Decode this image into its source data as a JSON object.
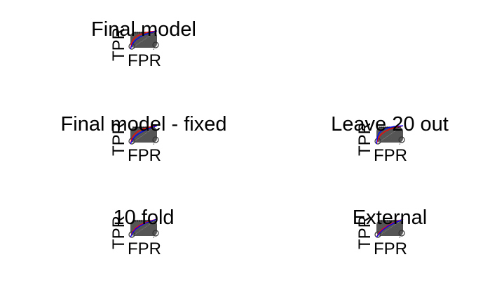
{
  "chart_data": [
    {
      "type": "line",
      "title": "Final model",
      "xlabel": "FPR",
      "ylabel": "TPR",
      "xlim": [
        0,
        1
      ],
      "ylim": [
        0,
        1
      ],
      "series": [
        {
          "color": "#ff0000",
          "x": [
            0,
            0.05,
            0.12,
            0.25,
            0.45,
            0.7,
            1
          ],
          "y": [
            0,
            0.35,
            0.55,
            0.72,
            0.85,
            0.95,
            1
          ]
        },
        {
          "color": "#0000ff",
          "x": [
            0,
            0.08,
            0.2,
            0.35,
            0.55,
            0.8,
            1
          ],
          "y": [
            0,
            0.3,
            0.5,
            0.66,
            0.8,
            0.92,
            1
          ]
        }
      ]
    },
    {
      "type": "line",
      "title": "Final model - fixed",
      "xlabel": "FPR",
      "ylabel": "TPR",
      "xlim": [
        0,
        1
      ],
      "ylim": [
        0,
        1
      ],
      "series": [
        {
          "color": "#ff0000",
          "x": [
            0,
            0.06,
            0.15,
            0.3,
            0.5,
            0.75,
            1
          ],
          "y": [
            0,
            0.32,
            0.52,
            0.7,
            0.83,
            0.94,
            1
          ]
        },
        {
          "color": "#0000ff",
          "x": [
            0,
            0.1,
            0.22,
            0.4,
            0.6,
            0.82,
            1
          ],
          "y": [
            0,
            0.28,
            0.47,
            0.64,
            0.78,
            0.91,
            1
          ]
        }
      ]
    },
    {
      "type": "line",
      "title": "Leave 20 out",
      "xlabel": "FPR",
      "ylabel": "TPR",
      "xlim": [
        0,
        1
      ],
      "ylim": [
        0,
        1
      ],
      "series": [
        {
          "color": "#ff0000",
          "x": [
            0,
            0.07,
            0.16,
            0.32,
            0.52,
            0.76,
            1
          ],
          "y": [
            0,
            0.3,
            0.5,
            0.68,
            0.82,
            0.93,
            1
          ]
        },
        {
          "color": "#0000ff",
          "x": [
            0,
            0.04,
            0.1,
            0.22,
            0.4,
            0.66,
            1
          ],
          "y": [
            0,
            0.4,
            0.6,
            0.76,
            0.87,
            0.96,
            1
          ]
        }
      ]
    },
    {
      "type": "line",
      "title": "10 fold",
      "xlabel": "FPR",
      "ylabel": "TPR",
      "xlim": [
        0,
        1
      ],
      "ylim": [
        0,
        1
      ],
      "series": [
        {
          "color": "#ff0000",
          "x": [
            0,
            0.08,
            0.18,
            0.34,
            0.54,
            0.78,
            1
          ],
          "y": [
            0,
            0.29,
            0.49,
            0.66,
            0.8,
            0.92,
            1
          ]
        },
        {
          "color": "#0000ff",
          "x": [
            0,
            0.09,
            0.2,
            0.37,
            0.57,
            0.8,
            1
          ],
          "y": [
            0,
            0.27,
            0.46,
            0.63,
            0.78,
            0.9,
            1
          ]
        }
      ]
    },
    {
      "type": "line",
      "title": "External",
      "xlabel": "FPR",
      "ylabel": "TPR",
      "xlim": [
        0,
        1
      ],
      "ylim": [
        0,
        1
      ],
      "series": [
        {
          "color": "#ff0000",
          "x": [
            0,
            0.1,
            0.22,
            0.4,
            0.6,
            0.82,
            1
          ],
          "y": [
            0,
            0.26,
            0.44,
            0.62,
            0.77,
            0.9,
            1
          ]
        },
        {
          "color": "#0000ff",
          "x": [
            0,
            0.12,
            0.25,
            0.42,
            0.62,
            0.84,
            1
          ],
          "y": [
            0,
            0.24,
            0.42,
            0.6,
            0.75,
            0.89,
            1
          ]
        }
      ]
    }
  ]
}
